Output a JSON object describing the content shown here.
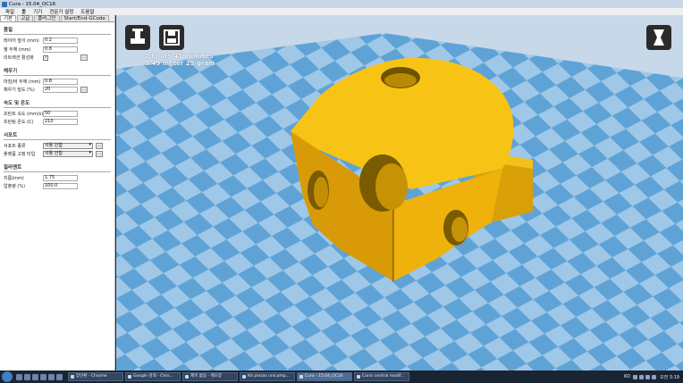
{
  "window": {
    "title": "Cura - 15.04_OC16"
  },
  "menu": [
    "파일",
    "툴",
    "기기",
    "전문가 설정",
    "도움말"
  ],
  "tabs": [
    "기본",
    "고급",
    "플러그인",
    "Start/End-GCode"
  ],
  "sections": [
    {
      "title": "품질",
      "rows": [
        {
          "label": "레이어 높이 (mm)",
          "type": "input",
          "value": "0.2"
        },
        {
          "label": "쉘 두께 (mm)",
          "type": "input",
          "value": "0.8"
        },
        {
          "label": "리트랙션 활성화",
          "type": "checkbox",
          "value": "✓",
          "button": "..."
        }
      ]
    },
    {
      "title": "채우기",
      "rows": [
        {
          "label": "마침/바 두께 (mm)",
          "type": "input",
          "value": "0.8"
        },
        {
          "label": "채우기 밀도 (%)",
          "type": "input",
          "value": "20",
          "button": "..."
        }
      ]
    },
    {
      "title": "속도 및 온도",
      "rows": [
        {
          "label": "프린트 속도 (mm/s)",
          "type": "input",
          "value": "50"
        },
        {
          "label": "프린팅 온도 (C)",
          "type": "input",
          "value": "210"
        }
      ]
    },
    {
      "title": "서포트",
      "rows": [
        {
          "label": "서포트 종류",
          "type": "select",
          "value": "사용 안함",
          "button": "..."
        },
        {
          "label": "플랫폼 고정 타입",
          "type": "select",
          "value": "사용 안함",
          "button": "..."
        }
      ]
    },
    {
      "title": "필라멘트",
      "rows": [
        {
          "label": "지름(mm)",
          "type": "input",
          "value": "1.75"
        },
        {
          "label": "압출량 (%)",
          "type": "input",
          "value": "100.0"
        }
      ]
    }
  ],
  "viewport": {
    "print_time": "2 hours 41 minutes",
    "material": "8.49 meter 25 gram"
  },
  "taskbar": {
    "tasks": [
      "장인환 - Chrome",
      "Google 검색 - Chro...",
      "제목 없음 - 메모장",
      "Kit piezas unicamp...",
      "Cura - 15.04_OC16",
      "Carro central modif..."
    ],
    "active_index": 4,
    "lang": "KO",
    "clock": "오전 3:19"
  },
  "colors": {
    "model": "#f2b90b",
    "grid_light": "#9fc7e8",
    "grid_dark": "#5fa3d6"
  }
}
